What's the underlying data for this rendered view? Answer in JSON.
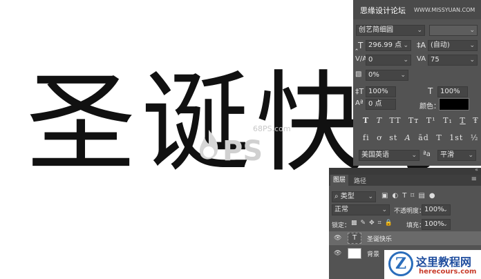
{
  "canvas": {
    "text": "圣诞快乐"
  },
  "watermark": {
    "site": "68PS.com",
    "ps_mark": "PS"
  },
  "char_panel": {
    "header_title": "思缘设计论坛",
    "header_site": "WWW.MISSYUAN.COM",
    "font_family": "创艺简细圆",
    "font_size": "296.99 点",
    "leading": "(自动)",
    "kerning": "0",
    "tracking": "75",
    "tsume": "0%",
    "vertical_scale": "100%",
    "horizontal_scale": "100%",
    "baseline_shift": "0 点",
    "color_label": "颜色：",
    "color": "#000000",
    "language": "美国英语",
    "aa_label": "ªa",
    "antialias": "平滑",
    "style_buttons": [
      "T",
      "T",
      "TT",
      "Tт",
      "T¹",
      "T₁",
      "T",
      "Ŧ"
    ],
    "opentype_buttons": [
      "fi",
      "ơ",
      "st",
      "A",
      "ād",
      "T",
      "1st",
      "½"
    ]
  },
  "layers_panel": {
    "tabs": [
      "图层",
      "路径"
    ],
    "filter_label": "类型",
    "blend_mode": "正常",
    "opacity_label": "不透明度：",
    "opacity": "100%",
    "lock_label": "锁定：",
    "fill_label": "填充：",
    "fill": "100%",
    "layers": [
      {
        "name": "圣诞快乐",
        "type": "text",
        "selected": true
      },
      {
        "name": "背景",
        "type": "image",
        "selected": false
      }
    ]
  },
  "logo": {
    "cn": "这里教程网",
    "en": "herecours.com",
    "mark": "Z"
  }
}
